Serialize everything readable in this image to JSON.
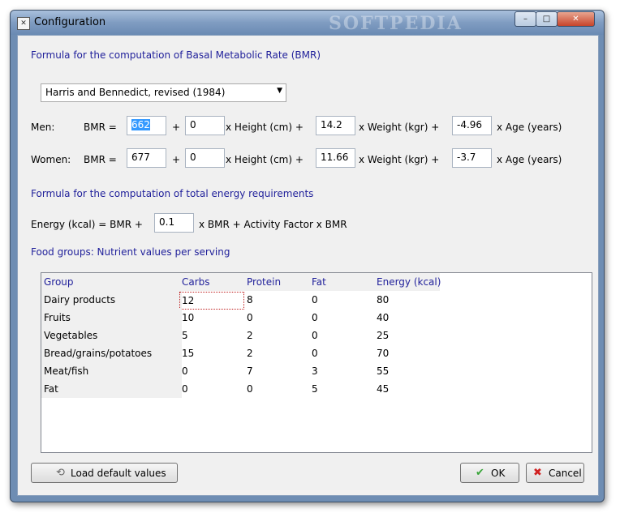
{
  "window": {
    "title": "Configuration",
    "watermark": "SOFTPEDIA",
    "minimize": "–",
    "maximize": "□",
    "close": "✕"
  },
  "bmr": {
    "heading": "Formula for the computation of Basal Metabolic Rate (BMR)",
    "formula_selected": "Harris and Bennedict, revised (1984)",
    "men": {
      "label": "Men:",
      "bmr_label": "BMR =",
      "constant": "662",
      "plus": "+",
      "height": "0",
      "height_label": "x Height (cm) +",
      "weight": "14.2",
      "weight_label": "x Weight (kgr) +",
      "age": "-4.96",
      "age_label": "x Age (years)"
    },
    "women": {
      "label": "Women:",
      "bmr_label": "BMR =",
      "constant": "677",
      "plus": "+",
      "height": "0",
      "height_label": "x Height (cm) +",
      "weight": "11.66",
      "weight_label": "x Weight (kgr) +",
      "age": "-3.7",
      "age_label": "x Age (years)"
    }
  },
  "energy": {
    "heading": "Formula for the computation of total energy requirements",
    "prefix": "Energy (kcal) = BMR +",
    "factor": "0.1",
    "suffix": "x BMR + Activity Factor x BMR"
  },
  "food": {
    "heading": "Food groups: Nutrient values per serving",
    "columns": [
      "Group",
      "Carbs",
      "Protein",
      "Fat",
      "Energy (kcal)"
    ],
    "rows": [
      [
        "Dairy products",
        "12",
        "8",
        "0",
        "80"
      ],
      [
        "Fruits",
        "10",
        "0",
        "0",
        "40"
      ],
      [
        "Vegetables",
        "5",
        "2",
        "0",
        "25"
      ],
      [
        "Bread/grains/potatoes",
        "15",
        "2",
        "0",
        "70"
      ],
      [
        "Meat/fish",
        "0",
        "7",
        "3",
        "55"
      ],
      [
        "Fat",
        "0",
        "0",
        "5",
        "45"
      ]
    ]
  },
  "buttons": {
    "load_default": "Load default values",
    "ok": "OK",
    "cancel": "Cancel"
  },
  "icons": {
    "load": "load-defaults-icon",
    "ok": "check-icon",
    "cancel": "cancel-x-icon"
  },
  "colors": {
    "heading": "#1f1f9a",
    "ok_icon": "#3aa53a",
    "cancel_icon": "#d02020"
  }
}
